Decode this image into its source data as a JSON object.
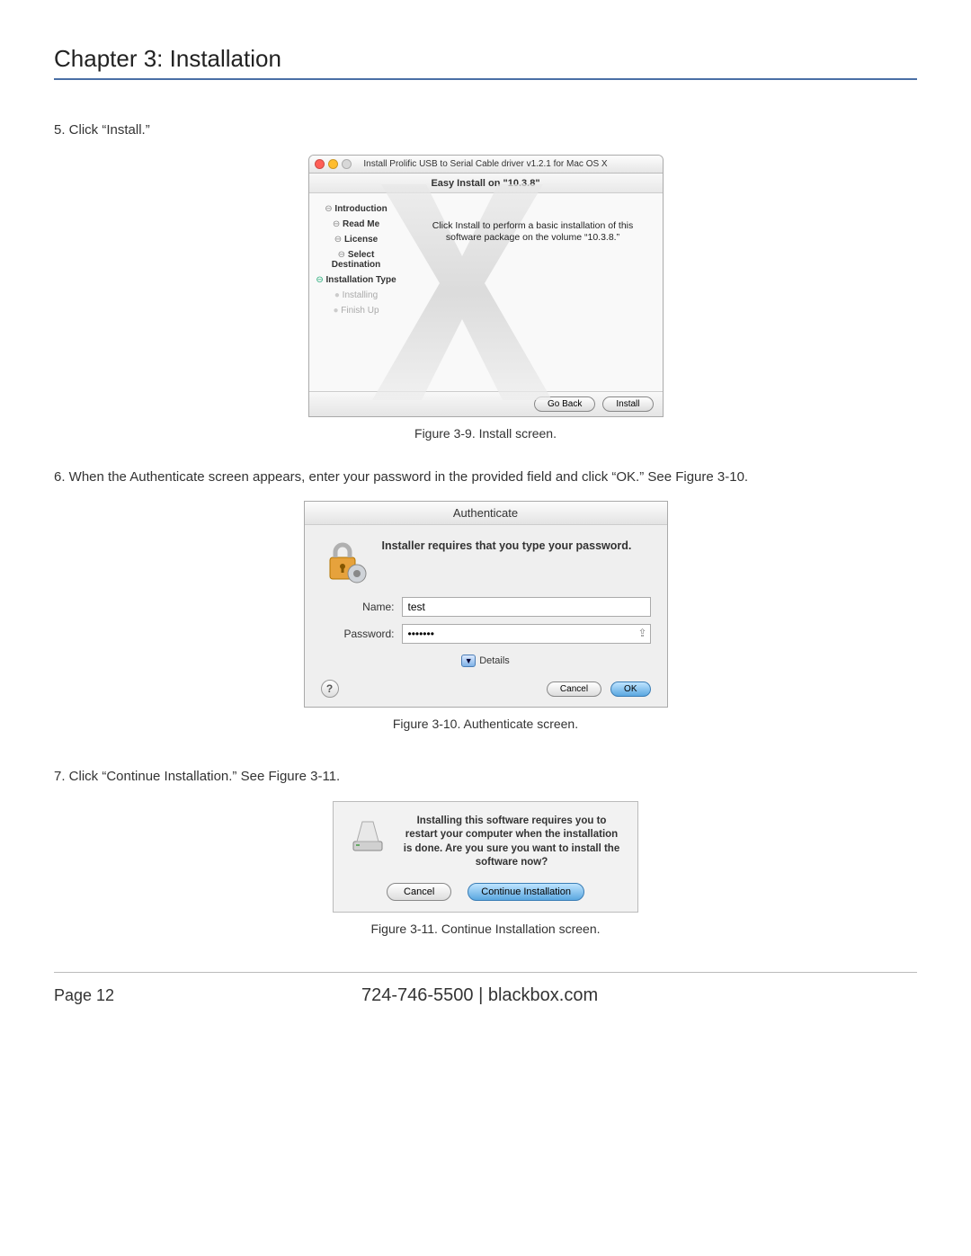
{
  "chapter_title": "Chapter 3: Installation",
  "step5": "5. Click “Install.”",
  "install_win": {
    "title": "Install Prolific USB to Serial Cable driver v1.2.1 for Mac OS X",
    "subtitle": "Easy Install on \"10.3.8\"",
    "steps": {
      "introduction": "Introduction",
      "read_me": "Read Me",
      "license": "License",
      "select_dest": "Select Destination",
      "install_type": "Installation Type",
      "installing": "Installing",
      "finish_up": "Finish Up"
    },
    "body_text": "Click Install to perform a basic installation of this software package on the volume “10.3.8.”",
    "go_back": "Go Back",
    "install": "Install"
  },
  "caption_9": "Figure 3-9. Install screen.",
  "step6": "6. When the Authenticate screen appears, enter your password in the provided field and click “OK.” See Figure 3-10.",
  "auth": {
    "title": "Authenticate",
    "prompt": "Installer requires that you type your password.",
    "name_label": "Name:",
    "name_value": "test",
    "password_label": "Password:",
    "password_value": "•••••••",
    "details": "Details",
    "cancel": "Cancel",
    "ok": "OK"
  },
  "caption_10": "Figure 3-10. Authenticate screen.",
  "step7": "7. Click “Continue Installation.” See Figure 3-11.",
  "cont": {
    "message": "Installing this software requires you to restart your computer when the installation is done.  Are you sure you want to install the software now?",
    "cancel": "Cancel",
    "continue": "Continue Installation"
  },
  "caption_11": "Figure 3-11. Continue Installation screen.",
  "footer": {
    "page": "Page 12",
    "phone": "724-746-5500",
    "sep": "   |   ",
    "site": "blackbox.com"
  }
}
